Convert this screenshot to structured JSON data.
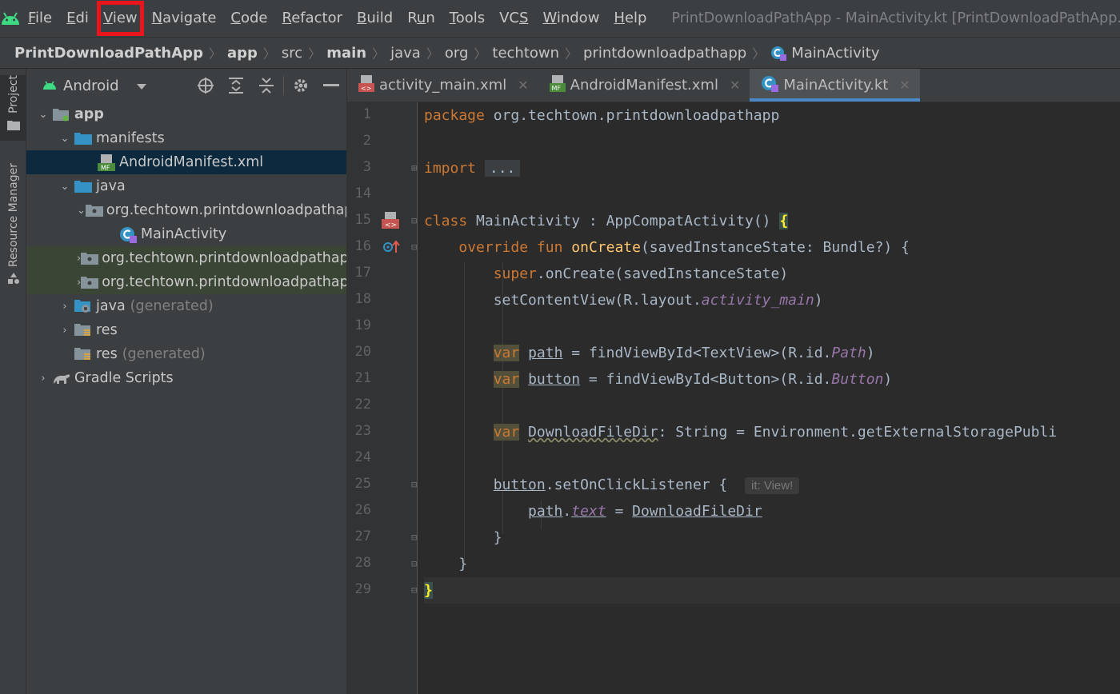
{
  "menubar": {
    "items": [
      {
        "label": "File",
        "mnemonic": "F",
        "rest": "ile"
      },
      {
        "label": "Edit",
        "mnemonic": "E",
        "rest": "di"
      },
      {
        "label": "View",
        "mnemonic": "V",
        "rest": "iew"
      },
      {
        "label": "Navigate",
        "mnemonic": "N",
        "rest": "avigate"
      },
      {
        "label": "Code",
        "mnemonic": "C",
        "rest": "ode"
      },
      {
        "label": "Refactor",
        "mnemonic": "R",
        "rest": "efactor"
      },
      {
        "label": "Build",
        "mnemonic": "B",
        "rest": "uild"
      },
      {
        "label": "Run",
        "mnemonic": "u",
        "rest": "Run"
      },
      {
        "label": "Tools",
        "mnemonic": "T",
        "rest": "ools"
      },
      {
        "label": "VCS",
        "mnemonic": "S",
        "rest": "VC"
      },
      {
        "label": "Window",
        "mnemonic": "W",
        "rest": "indow"
      },
      {
        "label": "Help",
        "mnemonic": "H",
        "rest": "elp"
      }
    ],
    "highlighted": "View",
    "highlight_color": "#e8151c",
    "window_title": "PrintDownloadPathApp - MainActivity.kt [PrintDownloadPathApp.app"
  },
  "breadcrumb": [
    "PrintDownloadPathApp",
    "app",
    "src",
    "main",
    "java",
    "org",
    "techtown",
    "printdownloadpathapp",
    "MainActivity"
  ],
  "toolstrip": {
    "project_label": "Project",
    "resource_label": "Resource Manager"
  },
  "project_panel": {
    "view_mode": "Android",
    "tree": {
      "app": "app",
      "manifests": "manifests",
      "manifest_file": "AndroidManifest.xml",
      "java": "java",
      "pkg_main": "org.techtown.printdownloadpathapp",
      "main_activity": "MainActivity",
      "pkg_android_test": "org.techtown.printdownloadpathapp",
      "pkg_test": "org.techtown.printdownloadpathapp",
      "java_generated": "java",
      "java_generated_suffix": "(generated)",
      "res": "res",
      "res_generated": "res",
      "res_generated_suffix": "(generated)",
      "gradle_scripts": "Gradle Scripts"
    }
  },
  "tabs": [
    {
      "label": "activity_main.xml",
      "active": false
    },
    {
      "label": "AndroidManifest.xml",
      "active": false
    },
    {
      "label": "MainActivity.kt",
      "active": true
    }
  ],
  "editor": {
    "line_numbers": [
      "1",
      "2",
      "3",
      "14",
      "15",
      "16",
      "17",
      "18",
      "19",
      "20",
      "21",
      "22",
      "23",
      "24",
      "25",
      "26",
      "27",
      "28",
      "29"
    ],
    "code": {
      "l1_kw": "package",
      "l1_pkg": " org.techtown.printdownloadpathapp",
      "l3_import": "import",
      "l3_fold": "...",
      "l15_kw": "class",
      "l15_name": "MainActivity",
      "l15_rest": " : AppCompatActivity() ",
      "l15_brace": "{",
      "l16_override": "override",
      "l16_fun": "fun",
      "l16_name": "onCreate",
      "l16_rest": "(savedInstanceState: Bundle?) {",
      "l17_super": "super",
      "l17_rest": ".onCreate(savedInstanceState)",
      "l18_call": "setContentView",
      "l18_rest": "(R.layout.",
      "l18_id": "activity_main",
      "l18_end": ")",
      "l20_var": "var",
      "l20_name": "path",
      "l20_eq": " = ",
      "l20_call": "findViewById",
      "l20_rest": "<TextView>(R.id.",
      "l20_id": "Path",
      "l20_end": ")",
      "l21_var": "var",
      "l21_name": "button",
      "l21_eq": " = ",
      "l21_call": "findViewById",
      "l21_rest": "<Button>(R.id.",
      "l21_id": "Button",
      "l21_end": ")",
      "l23_var": "var",
      "l23_name": "DownloadFileDir",
      "l23_rest": ": String = Environment.",
      "l23_call": "getExternalStoragePubli",
      "l25_name": "button",
      "l25_dot": ".",
      "l25_call": "setOnClickListener",
      "l25_rest": " {",
      "l25_hint": "it: View!",
      "l26_name": "path",
      "l26_dot": ".",
      "l26_prop": "text",
      "l26_eq": " = ",
      "l26_val": "DownloadFileDir",
      "l27": "}",
      "l28": "}",
      "l29": "}"
    }
  }
}
